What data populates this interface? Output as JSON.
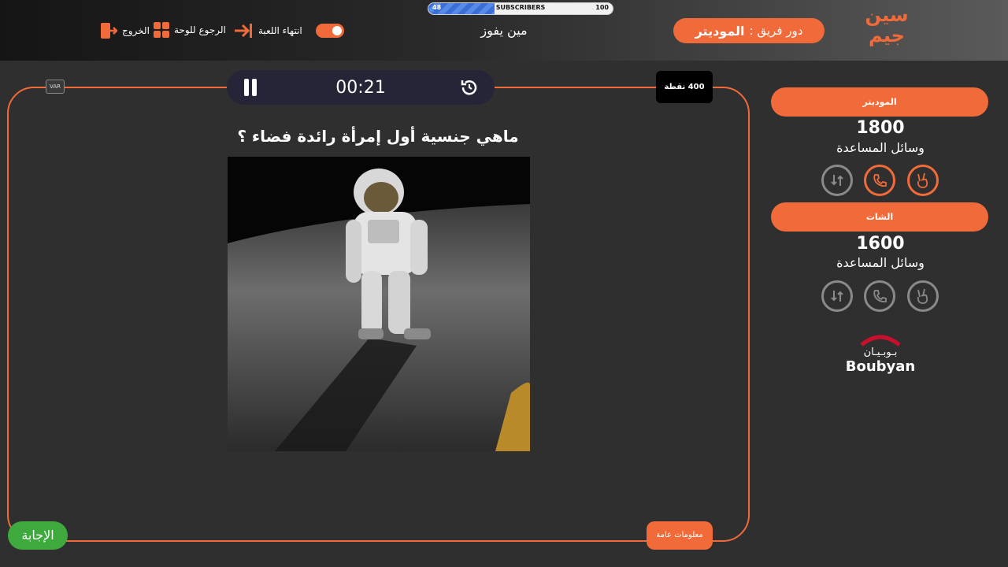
{
  "subscribers": {
    "min": "48",
    "label": "SUBSCRIBERS",
    "max": "100",
    "progress": 0.36
  },
  "header": {
    "exit_label": "الخروج",
    "board_label": "الرجوع للوحة",
    "end_game_label": "انتهاء اللعبة",
    "title": "مين يفوز",
    "turn_prefix": "دور فريق :",
    "turn_team": "الموديتر",
    "logo_text": "سين جيم"
  },
  "game": {
    "timer": "00:21",
    "var_label": "VAR",
    "points": "400 نقطة",
    "question": "ماهي جنسية أول إمرأة رائدة فضاء ؟",
    "category": "معلومات عامة",
    "answer_label": "الإجابة"
  },
  "teams": [
    {
      "name": "الموديتر",
      "score": "1800",
      "helpers_label": "وسائل المساعدة"
    },
    {
      "name": "الشات",
      "score": "1600",
      "helpers_label": "وسائل المساعدة"
    }
  ],
  "sponsor": {
    "arabic": "بـوبـيـان",
    "english": "Boubyan"
  },
  "colors": {
    "accent": "#f06a3a",
    "answer": "#3eaa3e",
    "timer_bg": "#262538",
    "bg": "#2f2f2f"
  },
  "icons": [
    "exit-icon",
    "grid-icon",
    "end-game-icon",
    "toggle-icon",
    "pause-icon",
    "reset-timer-icon",
    "swap-icon",
    "phone-icon",
    "peace-hand-icon"
  ]
}
